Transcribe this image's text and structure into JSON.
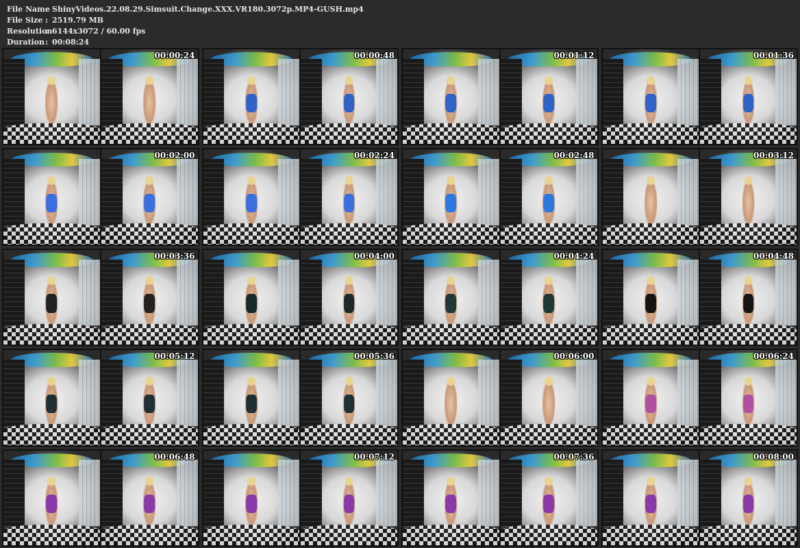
{
  "info": [
    {
      "label": "File Name",
      "value": "ShinyVideos.22.08.29.Simsuit.Change.XXX.VR180.3072p.MP4-GUSH.mp4"
    },
    {
      "label": "File Size",
      "value": "2519.79 MB"
    },
    {
      "label": "Resolution",
      "value": "6144x3072 / 60.00 fps"
    },
    {
      "label": "Duration",
      "value": "00:08:24"
    }
  ],
  "separator": ":",
  "thumbnails": [
    {
      "time": "00:00:24",
      "suit": "none"
    },
    {
      "time": "00:00:48",
      "suit": "#2f63c8"
    },
    {
      "time": "00:01:12",
      "suit": "#2f63c8"
    },
    {
      "time": "00:01:36",
      "suit": "#2f63c8"
    },
    {
      "time": "00:02:00",
      "suit": "#3b6fe0"
    },
    {
      "time": "00:02:24",
      "suit": "#3b6fe0"
    },
    {
      "time": "00:02:48",
      "suit": "#2d78e0"
    },
    {
      "time": "00:03:12",
      "suit": "none"
    },
    {
      "time": "00:03:36",
      "suit": "#222222"
    },
    {
      "time": "00:04:00",
      "suit": "#1a2a2a"
    },
    {
      "time": "00:04:24",
      "suit": "#1f3a34"
    },
    {
      "time": "00:04:48",
      "suit": "#151515"
    },
    {
      "time": "00:05:12",
      "suit": "#1f2f36"
    },
    {
      "time": "00:05:36",
      "suit": "#1f2f36"
    },
    {
      "time": "00:06:00",
      "suit": "none"
    },
    {
      "time": "00:06:24",
      "suit": "#b050a0"
    },
    {
      "time": "00:06:48",
      "suit": "#8a3aa8"
    },
    {
      "time": "00:07:12",
      "suit": "#8a3aa8"
    },
    {
      "time": "00:07:36",
      "suit": "#8a3aa8"
    },
    {
      "time": "00:08:00",
      "suit": "#8a3aa8"
    }
  ]
}
